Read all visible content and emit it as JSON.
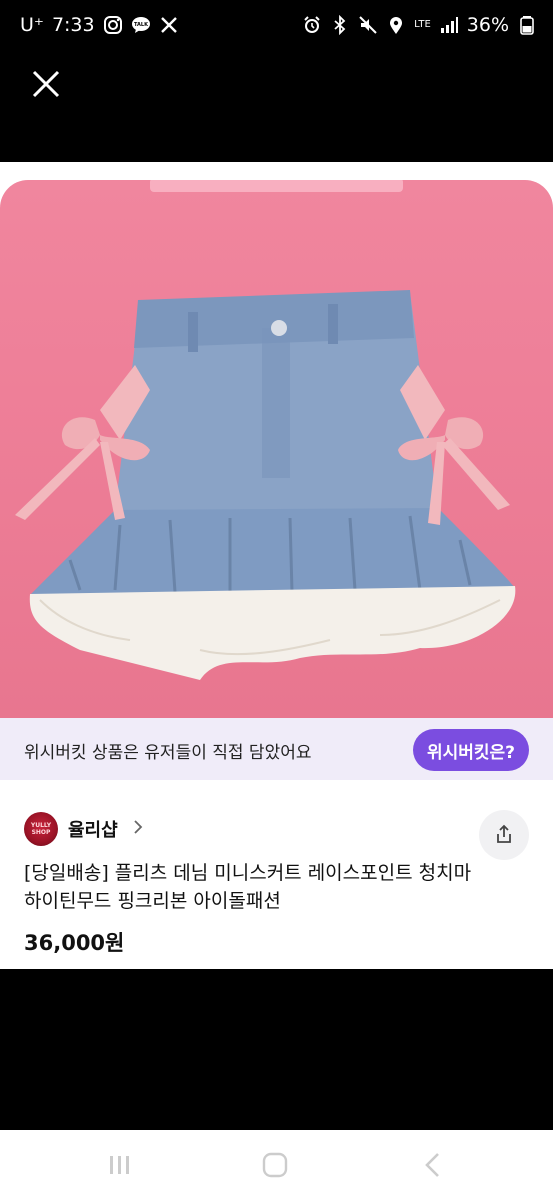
{
  "status_bar": {
    "carrier": "U⁺",
    "time": "7:33",
    "battery": "36%",
    "network": "LTE"
  },
  "colors": {
    "accent": "#7b4de0",
    "banner_bg": "#f0ecf9",
    "image_bg": "#ee7f98"
  },
  "banner": {
    "text": "위시버킷 상품은 유저들이 직접 담았어요",
    "button_label": "위시버킷은?"
  },
  "shop": {
    "logo_text": "YULLY SHOP",
    "name": "율리샵"
  },
  "product": {
    "title": "[당일배송] 플리츠 데님 미니스커트 레이스포인트 청치마 하이틴무드 핑크리본 아이돌패션",
    "price": "36,000원",
    "image_description_icon": "denim-skirt-image"
  }
}
